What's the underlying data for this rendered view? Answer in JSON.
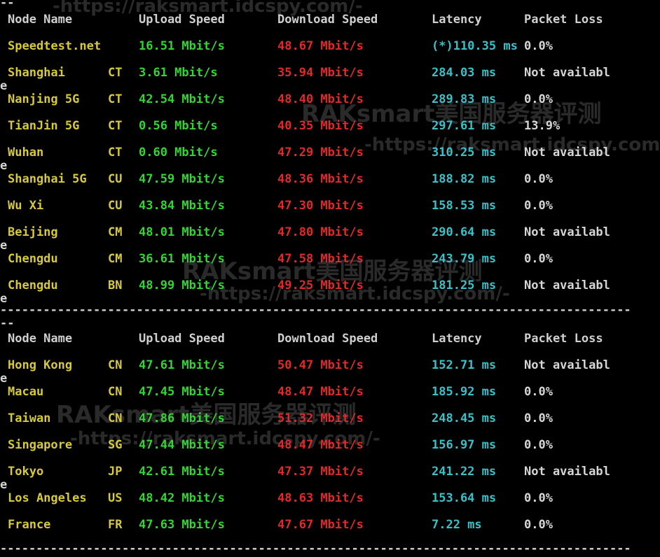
{
  "watermark": {
    "url": "-https://raksmart.idcspy.com/-",
    "brand": "RAKsmart美国服务器评测"
  },
  "separators": {
    "top_wrap": "--",
    "line": "----------------------------------------------------------------------------------------",
    "mid_wrap": "--"
  },
  "headers": {
    "node": "Node Name",
    "upload": "Upload Speed",
    "download": "Download Speed",
    "latency": "Latency",
    "loss": "Packet Loss"
  },
  "wrap_char": "e",
  "table1": [
    {
      "name": "Speedtest.net",
      "isp": "",
      "up": "16.51 Mbit/s",
      "down": "48.67 Mbit/s",
      "lat": "(*)110.35 ms",
      "loss": "0.0%",
      "wrap": false
    },
    {
      "name": "Shanghai",
      "isp": "CT",
      "up": "3.61 Mbit/s",
      "down": "35.94 Mbit/s",
      "lat": "284.03 ms",
      "loss": "Not availabl",
      "wrap": true
    },
    {
      "name": "Nanjing 5G",
      "isp": "CT",
      "up": "42.54 Mbit/s",
      "down": "48.40 Mbit/s",
      "lat": "289.83 ms",
      "loss": "0.0%",
      "wrap": false
    },
    {
      "name": "TianJin 5G",
      "isp": "CT",
      "up": "0.56 Mbit/s",
      "down": "40.35 Mbit/s",
      "lat": "297.61 ms",
      "loss": "13.9%",
      "wrap": false
    },
    {
      "name": "Wuhan",
      "isp": "CT",
      "up": "0.60 Mbit/s",
      "down": "47.29 Mbit/s",
      "lat": "310.25 ms",
      "loss": "Not availabl",
      "wrap": true
    },
    {
      "name": "Shanghai 5G",
      "isp": "CU",
      "up": "47.59 Mbit/s",
      "down": "48.36 Mbit/s",
      "lat": "188.82 ms",
      "loss": "0.0%",
      "wrap": false
    },
    {
      "name": "Wu Xi",
      "isp": "CU",
      "up": "43.84 Mbit/s",
      "down": "47.30 Mbit/s",
      "lat": "158.53 ms",
      "loss": "0.0%",
      "wrap": false
    },
    {
      "name": "Beijing",
      "isp": "CM",
      "up": "48.01 Mbit/s",
      "down": "47.80 Mbit/s",
      "lat": "290.64 ms",
      "loss": "Not availabl",
      "wrap": true
    },
    {
      "name": "Chengdu",
      "isp": "CM",
      "up": "36.61 Mbit/s",
      "down": "47.58 Mbit/s",
      "lat": "243.79 ms",
      "loss": "0.0%",
      "wrap": false
    },
    {
      "name": "Chengdu",
      "isp": "BN",
      "up": "48.99 Mbit/s",
      "down": "49.25 Mbit/s",
      "lat": "181.25 ms",
      "loss": "Not availabl",
      "wrap": true
    }
  ],
  "table2": [
    {
      "name": "Hong Kong",
      "isp": "CN",
      "up": "47.61 Mbit/s",
      "down": "50.47 Mbit/s",
      "lat": "152.71 ms",
      "loss": "Not availabl",
      "wrap": true
    },
    {
      "name": "Macau",
      "isp": "CN",
      "up": "47.45 Mbit/s",
      "down": "48.47 Mbit/s",
      "lat": "185.92 ms",
      "loss": "0.0%",
      "wrap": false
    },
    {
      "name": "Taiwan",
      "isp": "CN",
      "up": "47.86 Mbit/s",
      "down": "51.32 Mbit/s",
      "lat": "248.45 ms",
      "loss": "0.0%",
      "wrap": false
    },
    {
      "name": "Singapore",
      "isp": "SG",
      "up": "47.44 Mbit/s",
      "down": "48.47 Mbit/s",
      "lat": "156.97 ms",
      "loss": "0.0%",
      "wrap": false
    },
    {
      "name": "Tokyo",
      "isp": "JP",
      "up": "42.61 Mbit/s",
      "down": "47.37 Mbit/s",
      "lat": "241.22 ms",
      "loss": "Not availabl",
      "wrap": true
    },
    {
      "name": "Los Angeles",
      "isp": "US",
      "up": "48.42 Mbit/s",
      "down": "48.63 Mbit/s",
      "lat": "153.64 ms",
      "loss": "0.0%",
      "wrap": false
    },
    {
      "name": "France",
      "isp": "FR",
      "up": "47.63 Mbit/s",
      "down": "47.67 Mbit/s",
      "lat": "7.22 ms",
      "loss": "0.0%",
      "wrap": false
    }
  ],
  "colors": {
    "background": "#000000",
    "node": "#d6c93a",
    "upload": "#35d435",
    "download": "#e02a2a",
    "latency": "#3cc0c8",
    "header": "#d0d0d0"
  }
}
